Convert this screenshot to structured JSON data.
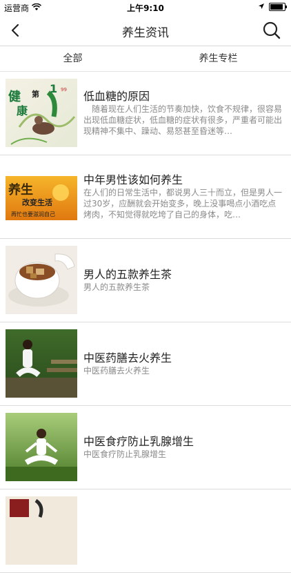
{
  "status_bar": {
    "carrier": "运营商",
    "time": "上午9:10"
  },
  "nav": {
    "title": "养生资讯",
    "back_icon": "chevron-left-icon",
    "search_icon": "search-icon"
  },
  "tabs": [
    {
      "label": "全部"
    },
    {
      "label": "养生专栏"
    }
  ],
  "thumb_texts": {
    "item0": [
      "健",
      "康",
      "第",
      "1",
      "99"
    ],
    "item1": [
      "养生",
      "改变生活",
      "再忙也要滋润自己"
    ]
  },
  "articles": [
    {
      "title": "低血糖的原因",
      "desc": "　随着现在人们生活的节奏加快，饮食不规律，很容易出现低血糖症状，低血糖的症状有很多，严重者可能出现精神不集中、躁动、易怒甚至昏迷等…"
    },
    {
      "title": "中年男性该如何养生",
      "desc": "在人们的日常生活中，都说男人三十而立，但是男人一过30岁，应酬就会开始变多，晚上没事喝点小酒吃点烤肉，不知觉得就吃垮了自己的身体，吃…"
    },
    {
      "title": "男人的五款养生茶",
      "desc": "男人的五款养生茶"
    },
    {
      "title": "中医药膳去火养生",
      "desc": "中医药膳去火养生"
    },
    {
      "title": "中医食疗防止乳腺增生",
      "desc": "中医食疗防止乳腺增生"
    },
    {
      "title": "",
      "desc": ""
    }
  ]
}
